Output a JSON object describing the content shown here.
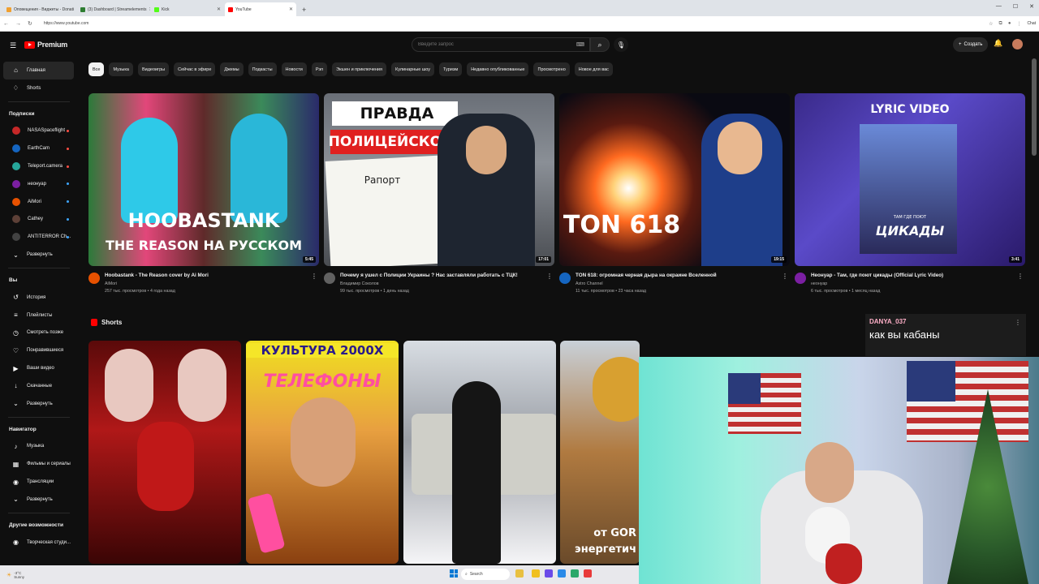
{
  "browser": {
    "tabs": [
      {
        "label": "Оповещения - Виджеты - Donati",
        "color": "#f0a030"
      },
      {
        "label": "(3) Dashboard | Streamelements",
        "color": "#2e7d32"
      },
      {
        "label": "Kick",
        "color": "#53fc18"
      },
      {
        "label": "YouTube",
        "color": "#ff0000"
      }
    ],
    "new_tab": "+",
    "url": "https://www.youtube.com",
    "chat_label": "Chat"
  },
  "header": {
    "logo_text": "Premium",
    "search_placeholder": "Введите запрос",
    "create_label": "Создать"
  },
  "sidebar": {
    "main": [
      {
        "label": "Главная",
        "icon": "home-icon",
        "glyph": "⌂"
      },
      {
        "label": "Shorts",
        "icon": "shorts-icon",
        "glyph": "♢"
      }
    ],
    "subscriptions_heading": "Подписки",
    "subscriptions": [
      {
        "label": "NASASpaceflight",
        "color": "#c62828",
        "live": "red"
      },
      {
        "label": "EarthCam",
        "color": "#1565c0",
        "live": "red"
      },
      {
        "label": "Teleport.camera",
        "color": "#26a69a",
        "live": "red"
      },
      {
        "label": "неонуар",
        "color": "#7b1fa2",
        "live": "blue"
      },
      {
        "label": "AiMori",
        "color": "#e65100",
        "live": "blue"
      },
      {
        "label": "Cathey",
        "color": "#5d4037",
        "live": "blue"
      },
      {
        "label": "ANTITERROR Ch...",
        "color": "#424242",
        "live": "blue"
      }
    ],
    "expand_label": "Развернуть",
    "you_heading": "Вы",
    "you_items": [
      {
        "label": "История",
        "glyph": "↺"
      },
      {
        "label": "Плейлисты",
        "glyph": "≡"
      },
      {
        "label": "Смотреть позже",
        "glyph": "◷"
      },
      {
        "label": "Понравившиеся",
        "glyph": "♡"
      },
      {
        "label": "Ваши видео",
        "glyph": "▶"
      },
      {
        "label": "Скачанные",
        "glyph": "↓"
      },
      {
        "label": "Развернуть",
        "glyph": "⌄"
      }
    ],
    "nav_heading": "Навигатор",
    "nav_items": [
      {
        "label": "Музыка",
        "glyph": "♪"
      },
      {
        "label": "Фильмы и сериалы",
        "glyph": "▦"
      },
      {
        "label": "Трансляции",
        "glyph": "◉"
      },
      {
        "label": "Развернуть",
        "glyph": "⌄"
      }
    ],
    "more_heading": "Другие возможности",
    "more_items": [
      {
        "label": "Творческая студи...",
        "glyph": "◉"
      }
    ]
  },
  "chips": [
    "Все",
    "Музыка",
    "Видеоигры",
    "Сейчас в эфире",
    "Джемы",
    "Подкасты",
    "Новости",
    "Рэп",
    "Экшен и приключения",
    "Кулинарные шоу",
    "Туризм",
    "Недавно опубликованные",
    "Просмотрено",
    "Новое для вас"
  ],
  "videos": [
    {
      "title": "Hoobastank - The Reason cover by Ai Mori",
      "channel": "AiMori",
      "stats": "257 тыс. просмотров • 4 года назад",
      "duration": "5:45",
      "thumb_line1": "HOOBASTANK",
      "thumb_line2": "THE REASON НА РУССКОМ",
      "avatar_color": "#e65100"
    },
    {
      "title": "Почему я ушел с Полиции Украины ? Нас заставляли работать с ТЦК!",
      "channel": "Владимир Соколов",
      "stats": "99 тыс. просмотров • 1 день назад",
      "duration": "17:01",
      "thumb_line1": "ПРАВДА",
      "thumb_line2": "ПОЛИЦЕЙСКОГО",
      "thumb_line3": "Рапорт",
      "avatar_color": "#616161"
    },
    {
      "title": "TON 618: огромная черная дыра на окраине Вселенной",
      "channel": "Astro Channel",
      "stats": "11 тыс. просмотров • 23 часа назад",
      "duration": "19:15",
      "thumb_line1": "TON 618",
      "avatar_color": "#1565c0"
    },
    {
      "title": "Неонуар - Там, где поют цикады (Official Lyric Video)",
      "channel": "неонуар",
      "stats": "6 тыс. просмотров • 1 месяц назад",
      "duration": "3:41",
      "thumb_line1": "LYRIC VIDEO",
      "thumb_line2": "ЦИКАДЫ",
      "thumb_line3": "ТАМ ГДЕ ПОЮТ",
      "avatar_color": "#7b1fa2"
    }
  ],
  "shorts": {
    "heading": "Shorts",
    "items": [
      {
        "text1": "",
        "text2": ""
      },
      {
        "text1": "КУЛЬТУРА 2000Х",
        "text2": "ТЕЛЕФОНЫ"
      },
      {
        "text1": "",
        "text2": ""
      },
      {
        "text1": "от GOR",
        "text2": "энергетич"
      }
    ]
  },
  "chat": {
    "user": "DANYA_037",
    "message": "как вы кабаны"
  },
  "taskbar": {
    "weather": "-3°C",
    "weather_sub": "Sunny",
    "search_label": "Search"
  }
}
